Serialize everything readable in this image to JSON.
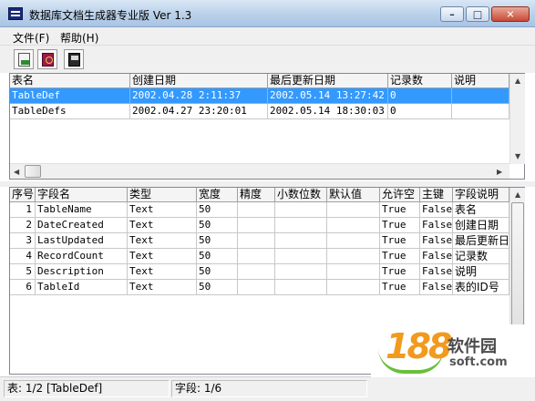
{
  "window": {
    "title": "数据库文档生成器专业版 Ver 1.3",
    "minimize_glyph": "–",
    "maximize_glyph": "□",
    "close_glyph": "✕"
  },
  "menu": [
    "文件(F)",
    "帮助(H)"
  ],
  "toolbar": {
    "buttons": [
      "open-db-icon",
      "key-icon",
      "export-doc-icon"
    ]
  },
  "tables_grid": {
    "columns": [
      "表名",
      "创建日期",
      "最后更新日期",
      "记录数",
      "说明"
    ],
    "rows": [
      {
        "name": "TableDef",
        "created": "2002.04.28 2:11:37",
        "updated": "2002.05.14 13:27:42",
        "count": "0",
        "desc": ""
      },
      {
        "name": "TableDefs",
        "created": "2002.04.27 23:20:01",
        "updated": "2002.05.14 18:30:03",
        "count": "0",
        "desc": ""
      }
    ],
    "selected_row": 0
  },
  "fields_grid": {
    "columns": [
      "序号",
      "字段名",
      "类型",
      "宽度",
      "精度",
      "小数位数",
      "默认值",
      "允许空",
      "主键",
      "字段说明"
    ],
    "rows": [
      [
        "1",
        "TableName",
        "Text",
        "50",
        "",
        "",
        "",
        "True",
        "False",
        "表名"
      ],
      [
        "2",
        "DateCreated",
        "Text",
        "50",
        "",
        "",
        "",
        "True",
        "False",
        "创建日期"
      ],
      [
        "3",
        "LastUpdated",
        "Text",
        "50",
        "",
        "",
        "",
        "True",
        "False",
        "最后更新日"
      ],
      [
        "4",
        "RecordCount",
        "Text",
        "50",
        "",
        "",
        "",
        "True",
        "False",
        "记录数"
      ],
      [
        "5",
        "Description",
        "Text",
        "50",
        "",
        "",
        "",
        "True",
        "False",
        "说明"
      ],
      [
        "6",
        "TableId",
        "Text",
        "50",
        "",
        "",
        "",
        "True",
        "False",
        "表的ID号"
      ]
    ]
  },
  "status": {
    "table": "表: 1/2  [TableDef]",
    "field": "字段: 1/6"
  },
  "watermark": {
    "digits": "188",
    "name": "软件园",
    "url": "soft.com"
  },
  "colors": {
    "selection": "#3399ff",
    "titlebar": "#bcd2ea"
  }
}
